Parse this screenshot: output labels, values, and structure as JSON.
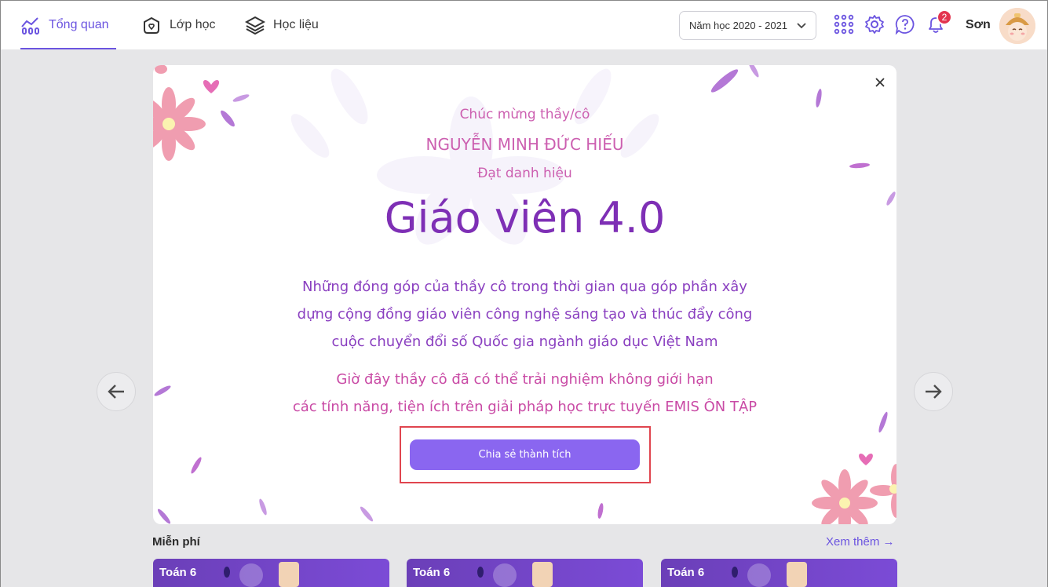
{
  "nav": {
    "tabs": [
      {
        "label": "Tổng quan",
        "icon": "chart-icon",
        "active": true
      },
      {
        "label": "Lớp học",
        "icon": "class-icon",
        "active": false
      },
      {
        "label": "Học liệu",
        "icon": "layers-icon",
        "active": false
      }
    ],
    "year_select": "Năm học 2020 - 2021",
    "notification_count": "2",
    "user_name": "Sơn"
  },
  "background": {
    "section_title": "Miễn phí",
    "see_more": "Xem thêm →",
    "cards": [
      {
        "label": "Toán 6"
      },
      {
        "label": "Toán 6"
      },
      {
        "label": "Toán 6"
      }
    ]
  },
  "modal": {
    "congrats": "Chúc mừng thầy/cô",
    "teacher_name": "NGUYỄN MINH ĐỨC HIẾU",
    "achieve": "Đạt danh hiệu",
    "title": "Giáo viên 4.0",
    "description": [
      "Những đóng góp của thầy cô trong thời gian qua góp phần xây",
      "dựng cộng đồng giáo viên công nghệ sáng tạo và thúc đẩy công",
      "cuộc chuyển đổi số Quốc gia ngành giáo dục Việt Nam"
    ],
    "description2": [
      "Giờ đây thầy cô đã có thể trải nghiệm không giới hạn",
      "các tính năng, tiện ích trên giải pháp học trực tuyến EMIS ÔN TẬP"
    ],
    "share_button": "Chia sẻ thành tích"
  },
  "colors": {
    "accent": "#6b54e0",
    "title": "#7e2fb5",
    "pink_text": "#cc5fb0",
    "button": "#8a66f0",
    "highlight": "#e0454f"
  }
}
